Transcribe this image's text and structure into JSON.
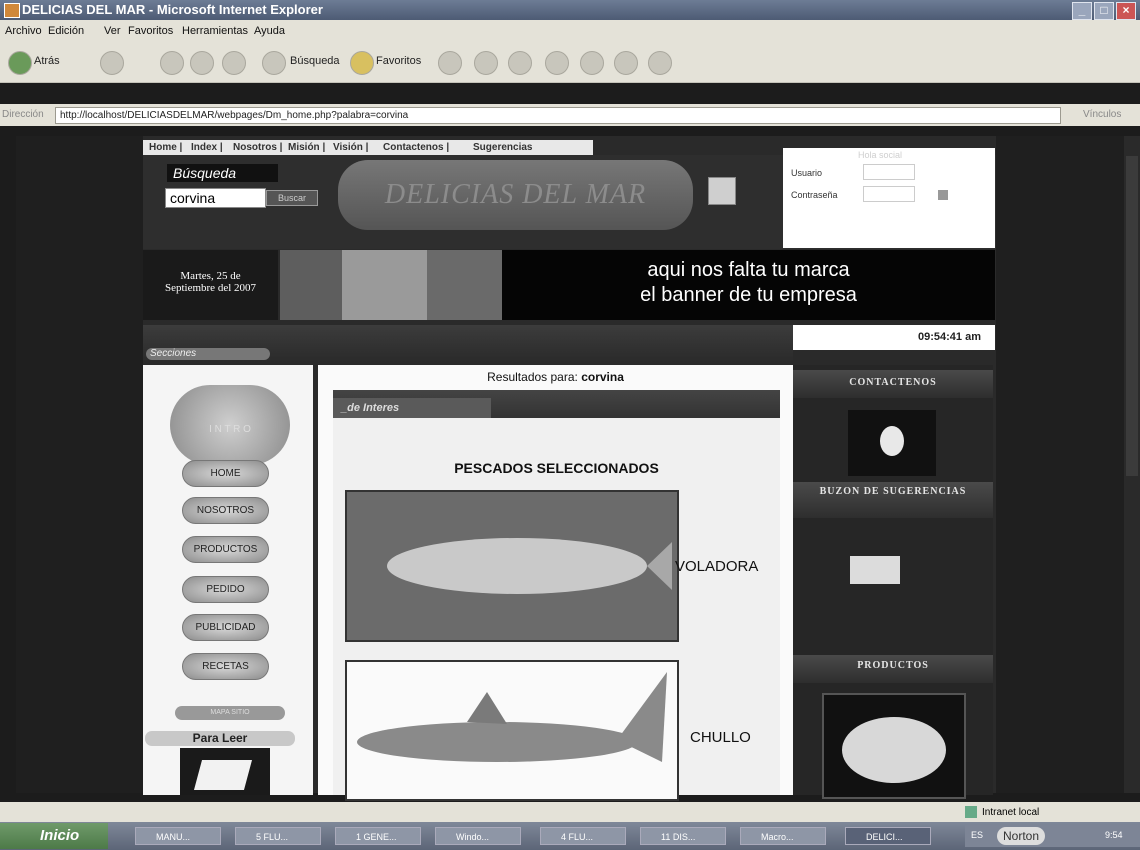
{
  "window": {
    "title": "DELICIAS DEL MAR - Microsoft Internet Explorer"
  },
  "menu": [
    "Archivo",
    "Edición",
    "Ver",
    "Favoritos",
    "Herramientas",
    "Ayuda"
  ],
  "toolbar": {
    "back": "Atrás",
    "search": "Búsqueda",
    "favorites": "Favoritos"
  },
  "address": {
    "label": "Dirección",
    "url": "http://localhost/DELICIASDELMAR/webpages/Dm_home.php?palabra=corvina",
    "links": "Vínculos"
  },
  "site": {
    "topnav": [
      "Home",
      "Index",
      "Nosotros",
      "Misión",
      "Visión",
      "Contactenos",
      "Sugerencias"
    ],
    "search_label": "Búsqueda",
    "search_value": "corvina",
    "search_button": "Buscar",
    "logo_text": "DELICIAS DEL MAR",
    "login_hint": "Hola social",
    "user_label": "Usuario",
    "pass_label": "Contraseña",
    "date_line1": "Martes, 25 de",
    "date_line2": "Septiembre del 2007",
    "banner_line1": "aqui  nos  falta  tu  marca",
    "banner_line2": "el  banner  de  tu  empresa",
    "clock": "09:54:41 am",
    "sections_label": "Secciones",
    "intro_label": "I N T R O",
    "left_nav": [
      "HOME",
      "NOSOTROS",
      "PRODUCTOS",
      "PEDIDO",
      "PUBLICIDAD",
      "RECETAS"
    ],
    "site_map": "MAPA SITIO",
    "para_leer": "Para Leer",
    "results_prefix": "Resultados para: ",
    "results_term": "corvina",
    "tab_label": "_de Interes",
    "panel_title": "PESCADOS SELECCIONADOS",
    "fish": [
      "VOLADORA",
      "CHULLO"
    ],
    "right_heads": [
      "CONTACTENOS",
      "BUZON DE SUGERENCIAS",
      "PRODUCTOS"
    ]
  },
  "status": {
    "zone": "Intranet local"
  },
  "taskbar": {
    "start": "Inicio",
    "tasks": [
      "MANU...",
      "5 FLU...",
      "1 GENE...",
      "Windo...",
      "4 FLU...",
      "11 DIS...",
      "Macro...",
      "DELICI..."
    ],
    "tray_lang": "ES",
    "tray_av": "Norton",
    "tray_time": "9:54"
  }
}
